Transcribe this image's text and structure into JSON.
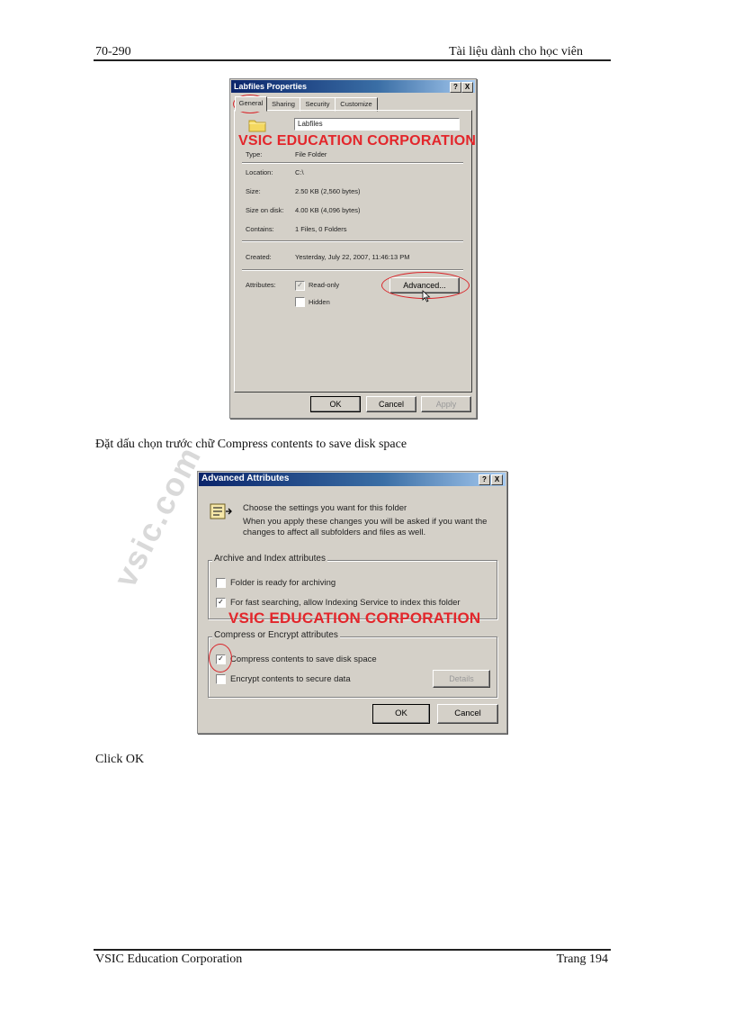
{
  "page_header": {
    "left": "70-290",
    "right": "Tài liệu dành cho học viên"
  },
  "page_footer": {
    "left": "VSIC Education Corporation",
    "right": "Trang 194"
  },
  "paragraphs": {
    "p1": "Đặt dấu chọn trước chữ Compress contents to save disk space",
    "p2": "Click OK"
  },
  "watermark": "VSIC EDUCATION CORPORATION",
  "side_watermark": "vsic.com",
  "dialog1": {
    "title": "Labfiles Properties",
    "title_buttons": {
      "help": "?",
      "close": "X"
    },
    "tabs": [
      "General",
      "Sharing",
      "Security",
      "Customize"
    ],
    "name_value": "Labfiles",
    "rows": [
      {
        "label": "Type:",
        "value": "File Folder"
      },
      {
        "label": "Location:",
        "value": "C:\\"
      },
      {
        "label": "Size:",
        "value": "2.50 KB (2,560 bytes)"
      },
      {
        "label": "Size on disk:",
        "value": "4.00 KB (4,096 bytes)"
      },
      {
        "label": "Contains:",
        "value": "1 Files, 0 Folders"
      },
      {
        "label": "Created:",
        "value": "Yesterday, July 22, 2007, 11:46:13 PM"
      }
    ],
    "attributes_label": "Attributes:",
    "readonly_label": "Read-only",
    "hidden_label": "Hidden",
    "advanced_button": "Advanced...",
    "ok": "OK",
    "cancel": "Cancel",
    "apply": "Apply"
  },
  "dialog2": {
    "title": "Advanced Attributes",
    "title_buttons": {
      "help": "?",
      "close": "X"
    },
    "intro1": "Choose the settings you want for this folder",
    "intro2": "When you apply these changes you will be asked if you want the changes to affect all subfolders and files as well.",
    "group1_label": "Archive and Index attributes",
    "archive_label": "Folder is ready for archiving",
    "index_label": "For fast searching, allow Indexing Service to index this folder",
    "group2_label": "Compress or Encrypt attributes",
    "compress_label": "Compress contents to save disk space",
    "encrypt_label": "Encrypt contents to secure data",
    "details_button": "Details",
    "ok": "OK",
    "cancel": "Cancel"
  },
  "checkbox_states": {
    "readonly": true,
    "hidden": false,
    "archive": false,
    "index": true,
    "compress": true,
    "encrypt": false
  }
}
